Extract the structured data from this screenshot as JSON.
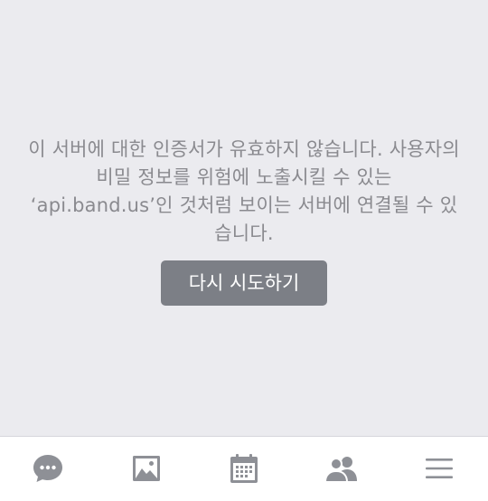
{
  "error": {
    "message": "이 서버에 대한 인증서가 유효하지 않습니다. 사용자의 비밀 정보를 위험에 노출시킬 수 있는 ‘api.band.us’인 것처럼 보이는 서버에 연결될 수 있습니다."
  },
  "retry_button": {
    "label": "다시 시도하기"
  },
  "tabbar": {
    "items": [
      {
        "icon": "chat-bubble-icon"
      },
      {
        "icon": "photo-icon"
      },
      {
        "icon": "calendar-icon"
      },
      {
        "icon": "members-icon"
      },
      {
        "icon": "menu-icon"
      }
    ]
  },
  "colors": {
    "background": "#ebebef",
    "text": "#8a8a8f",
    "button": "#7c7f86",
    "icon": "#8e9096",
    "tabbar": "#ffffff"
  }
}
